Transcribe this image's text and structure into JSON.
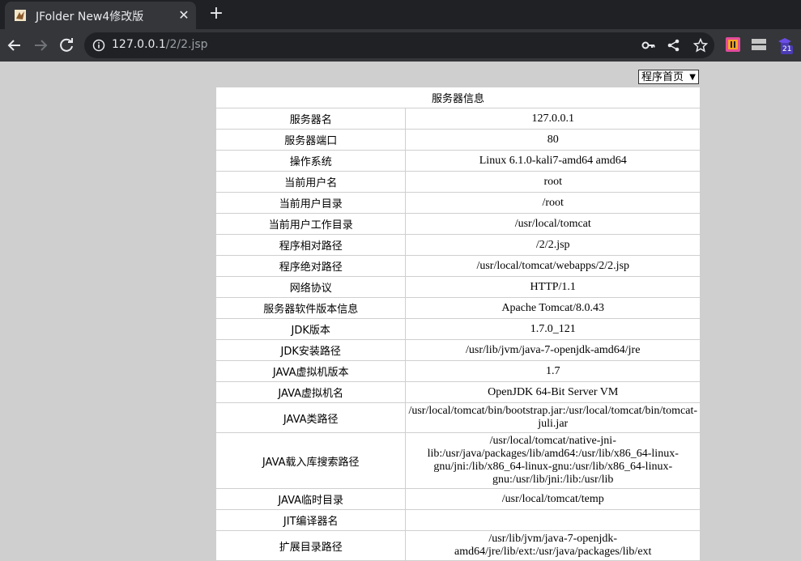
{
  "browser": {
    "tab_title": "JFolder New4修改版",
    "url_host": "127.0.0.1",
    "url_path": "/2/2.jsp",
    "extension_badge": "21"
  },
  "page": {
    "select_value": "程序首页",
    "table_header": "服务器信息",
    "rows": [
      {
        "key": "服务器名",
        "value": "127.0.0.1"
      },
      {
        "key": "服务器端口",
        "value": "80"
      },
      {
        "key": "操作系统",
        "value": "Linux 6.1.0-kali7-amd64 amd64"
      },
      {
        "key": "当前用户名",
        "value": "root"
      },
      {
        "key": "当前用户目录",
        "value": "/root"
      },
      {
        "key": "当前用户工作目录",
        "value": "/usr/local/tomcat"
      },
      {
        "key": "程序相对路径",
        "value": "/2/2.jsp"
      },
      {
        "key": "程序绝对路径",
        "value": "/usr/local/tomcat/webapps/2/2.jsp"
      },
      {
        "key": "网络协议",
        "value": "HTTP/1.1"
      },
      {
        "key": "服务器软件版本信息",
        "value": "Apache Tomcat/8.0.43"
      },
      {
        "key": "JDK版本",
        "value": "1.7.0_121"
      },
      {
        "key": "JDK安装路径",
        "value": "/usr/lib/jvm/java-7-openjdk-amd64/jre"
      },
      {
        "key": "JAVA虚拟机版本",
        "value": "1.7"
      },
      {
        "key": "JAVA虚拟机名",
        "value": "OpenJDK 64-Bit Server VM"
      },
      {
        "key": "JAVA类路径",
        "value": "/usr/local/tomcat/bin/bootstrap.jar:/usr/local/tomcat/bin/tomcat-juli.jar"
      },
      {
        "key": "JAVA载入库搜索路径",
        "value": "/usr/local/tomcat/native-jni-lib:/usr/java/packages/lib/amd64:/usr/lib/x86_64-linux-gnu/jni:/lib/x86_64-linux-gnu:/usr/lib/x86_64-linux-gnu:/usr/lib/jni:/lib:/usr/lib"
      },
      {
        "key": "JAVA临时目录",
        "value": "/usr/local/tomcat/temp"
      },
      {
        "key": "JIT编译器名",
        "value": ""
      },
      {
        "key": "扩展目录路径",
        "value": "/usr/lib/jvm/java-7-openjdk-amd64/jre/lib/ext:/usr/java/packages/lib/ext"
      }
    ]
  }
}
